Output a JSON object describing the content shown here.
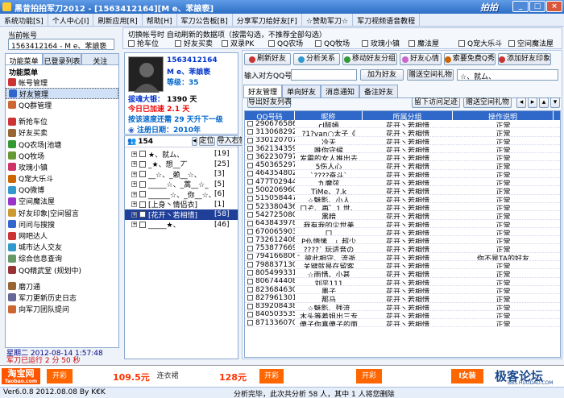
{
  "window": {
    "title": "黑昔拍拍军刀2012 - [1563412164][M e、苯誏亵]"
  },
  "menu": [
    "系统功能[S]",
    "个人中心[I]",
    "刷新应用[R]",
    "帮助[H]",
    "军刀公告板[B]",
    "分享军刀给好友[F]",
    "☆赞助军刀☆",
    "军刀视频语音教程"
  ],
  "account": {
    "label": "当前帐号",
    "value": "1563412164 - M e、苯誏亵"
  },
  "left_tabs": [
    "功能菜单",
    "已登录列表",
    "关注"
  ],
  "func_header": "功能菜单",
  "func_items": [
    {
      "label": "帐号管理",
      "color": "#cc3333"
    },
    {
      "label": "好友管理",
      "color": "#3366cc",
      "selected": true
    },
    {
      "label": "QQ群管理",
      "color": "#cc6633"
    },
    {
      "sep": true
    },
    {
      "label": "新抢车位",
      "color": "#cc3333"
    },
    {
      "label": "好友买卖",
      "color": "#996633"
    },
    {
      "label": "QQ农场|池塘",
      "color": "#339933"
    },
    {
      "label": "QQ牧场",
      "color": "#669933"
    },
    {
      "label": "玫瑰小镇",
      "color": "#cc3366"
    },
    {
      "label": "Q宠大乐斗",
      "color": "#cc6600"
    },
    {
      "label": "QQ微博",
      "color": "#3399cc"
    },
    {
      "label": "空间魔法屋",
      "color": "#9933cc"
    },
    {
      "label": "好友印象|空间留言",
      "color": "#cc9933"
    },
    {
      "label": "问问与搜搜",
      "color": "#3366cc"
    },
    {
      "label": "网吧达人",
      "color": "#cc3333"
    },
    {
      "label": "城市达人交友",
      "color": "#3399cc"
    },
    {
      "label": "综合信息查询",
      "color": "#669966"
    },
    {
      "label": "QQ精武堂 (规划中)",
      "color": "#993333"
    },
    {
      "sep": true
    },
    {
      "label": "磨刀通",
      "color": "#996633"
    },
    {
      "label": "军刀更新历史日志",
      "color": "#666699"
    },
    {
      "label": "向军刀团队提问",
      "color": "#cc6633"
    }
  ],
  "left_footer": {
    "date": "星期二  2012-08-14  1:57:48",
    "online": "军刀已运行 2 分 50 秒"
  },
  "profile": {
    "qq": "1563412164",
    "nick": "M e、苯誏亵",
    "level": "等级：35",
    "coins_label": "拔魂大银：",
    "coins": "1390 天",
    "today": "今日已加速 2.1 天",
    "speed": "按该速度还需 29 天升下一级",
    "reg": "注册日期：2010年"
  },
  "tree": {
    "count": "154",
    "loc_label": "定位",
    "import_label": "导入右侧",
    "groups": [
      {
        "name": "★、就ム、",
        "n": "[19]"
      },
      {
        "name": "_★、想__丆",
        "n": "[25]"
      },
      {
        "name": "__☆、_赖__☆、",
        "n": "[3]"
      },
      {
        "name": "_____☆、_蒿__☆_",
        "n": "[5]"
      },
      {
        "name": "______☆、_你__☆、",
        "n": "[6]"
      },
      {
        "name": "[上身丶情侣衣]",
        "n": "[1]"
      },
      {
        "name": "[花开丶若相惜]",
        "n": "[58]",
        "on": true
      },
      {
        "name": "_____★、",
        "n": "[46]"
      }
    ]
  },
  "switch": {
    "title": "切换帐号时  自动刷新的数据项（按需勾选，不推荐全部勾选）",
    "items": [
      "抢车位",
      "好友买卖",
      "双录PK",
      "QQ农场",
      "QQ牧场",
      "玫瑰小镇",
      "魔法屋",
      "Q宠大乐斗",
      "空间魔法屋"
    ]
  },
  "actions": [
    "刷新好友",
    "分析关系",
    "移动好友分组",
    "好友心情",
    "索要免费Q秀",
    "添加好友印象"
  ],
  "qqinput": {
    "label": "输入对方QQ号",
    "add": "加为好友",
    "send": "赠送空间礼物",
    "select": "☆、就ム、"
  },
  "subtabs": [
    "好友管理",
    "单向好友",
    "消息通知",
    "备注好友"
  ],
  "exportbtn": "导出好友列表",
  "tablebtns": [
    "留下访问足迹",
    "赠送空间礼物"
  ],
  "table": {
    "headers": [
      "QQ号码",
      "昵称",
      "所属分组",
      "操作说明"
    ],
    "rows": [
      [
        "290676586",
        "cl醉嫣",
        "花开丶若相惜",
        "正常"
      ],
      [
        "313068292",
        "?1?van○太子《",
        "花开丶若相惜",
        "正常"
      ],
      [
        "330120707",
        "冷天",
        "花开丶若相惜",
        "正常"
      ],
      [
        "362134359",
        "唯你守候",
        "花开丶若相惜",
        "正常"
      ],
      [
        "362230797",
        "发霉的女人推出去",
        "花开丶若相惜",
        "正常"
      ],
      [
        "450365297",
        "5伤人心",
        "花开丶若相惜",
        "正常"
      ],
      [
        "464354802",
        "`????奋斗`",
        "花开丶若相惜",
        "正常"
      ],
      [
        "477T02944",
        "九魔弦",
        "花开丶若相惜",
        "正常"
      ],
      [
        "500206960",
        "TiMe、7.k",
        "花开丶若相惜",
        "正常"
      ],
      [
        "515058447",
        "☆魅影、小人",
        "花开丶若相惜",
        "正常"
      ],
      [
        "523380436",
        "口ぞ、再゛1 世、",
        "花开丶若相惜",
        "正常"
      ],
      [
        "542725080",
        "黑暗",
        "花开丶若相惜",
        "正常"
      ],
      [
        "643843978",
        "我有我的尘世美",
        "花开丶若相惜",
        "正常"
      ],
      [
        "670065903",
        "口",
        "花开丶若相惜",
        "正常"
      ],
      [
        "732612408",
        "P仫情愫...」超少",
        "花开丶若相惜",
        "正常"
      ],
      [
        "753877669",
        "????`  玩适音の",
        "花开丶若相惜",
        "正常"
      ],
      [
        "794166806",
        "゛彼此相守、流逝..",
        "花开丶若相惜",
        "你不是TA的好友"
      ],
      [
        "798837130",
        "关键就是在留客",
        "花开丶若相惜",
        "正常"
      ],
      [
        "805499331",
        "☆雨惜、小甚",
        "花开丶若相惜",
        "正常"
      ],
      [
        "806744408",
        "刘平111",
        "花开丶若相惜",
        "正常"
      ],
      [
        "823684630",
        "墨子",
        "花开丶若相惜",
        "正常"
      ],
      [
        "827961301",
        "那马",
        "花开丶若相惜",
        "正常"
      ],
      [
        "839208438",
        "☆魅影、残流",
        "花开丶若相惜",
        "正常"
      ],
      [
        "840503535",
        "木头等着姐出三专",
        "花开丶若相惜",
        "正常"
      ],
      [
        "871336070",
        "傻子你真傻子的面",
        "花开丶若相惜",
        "正常"
      ]
    ]
  },
  "ads": [
    "淘宝网",
    "开彩",
    "109.5元",
    "连衣裙",
    "128元",
    "开彩",
    "开彩",
    "I女装"
  ],
  "ad_sub": "Taobao.com",
  "watermark": "极客论坛",
  "watermark_url": "BBS.HUODAO.COM",
  "status": {
    "ver": "Ver6.0.8  2012.08.08  By K€K",
    "msg": "分析完毕，此次共分析 58 人，其中  1  人将您删除"
  }
}
